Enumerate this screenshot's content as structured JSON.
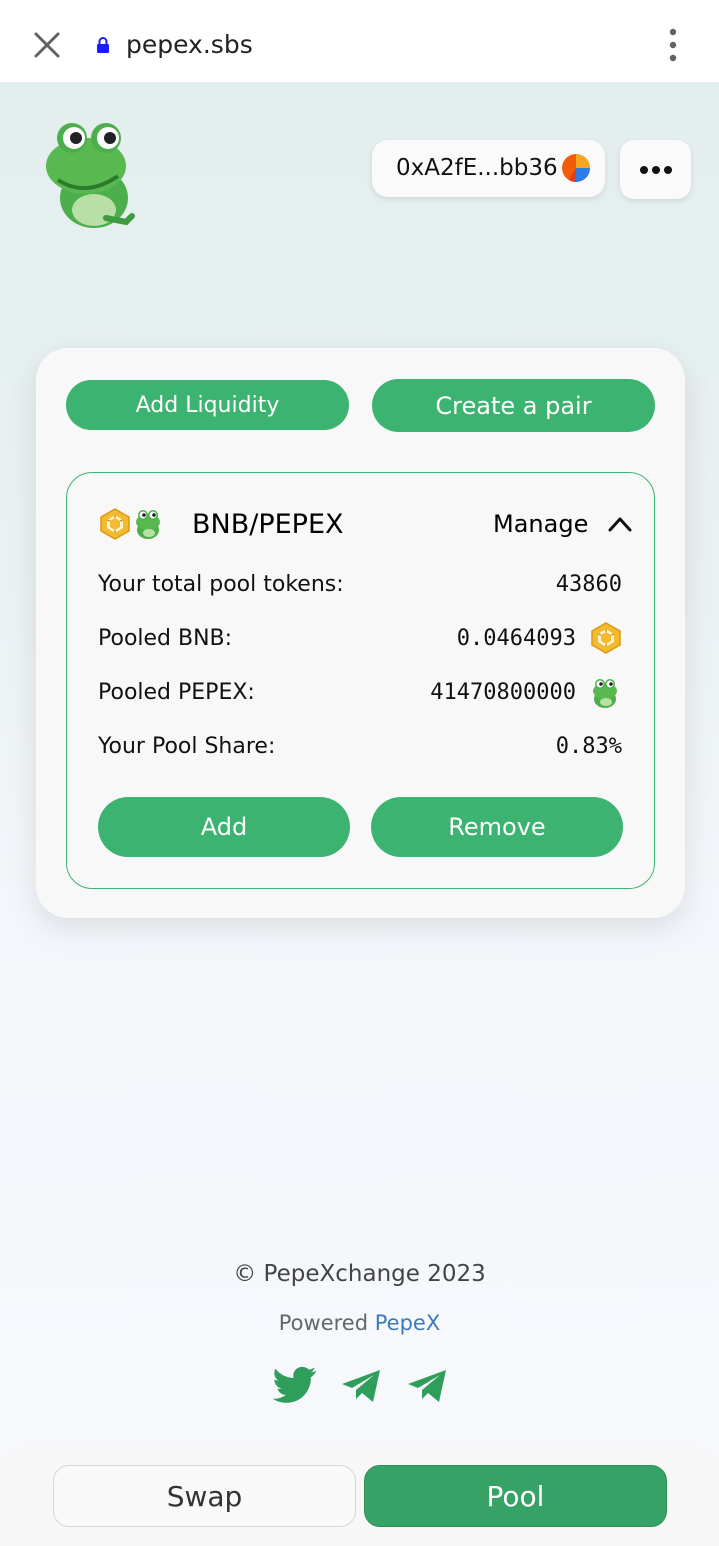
{
  "browser": {
    "url": "pepex.sbs",
    "icons": [
      "close-icon",
      "lock-icon",
      "more-vertical-icon"
    ]
  },
  "header": {
    "wallet_address": "0xA2fE...bb36",
    "logo_icon": "pepe-frog-icon",
    "more_icon": "more-horizontal-icon"
  },
  "pool": {
    "add_liquidity_label": "Add Liquidity",
    "create_pair_label": "Create a pair",
    "pair": {
      "name": "BNB/PEPEX",
      "manage_label": "Manage",
      "rows": [
        {
          "label": "Your total pool tokens:",
          "value": "43860"
        },
        {
          "label": "Pooled BNB:",
          "value": "0.0464093",
          "icon": "bnb-icon"
        },
        {
          "label": "Pooled PEPEX:",
          "value": "41470800000",
          "icon": "pepe-frog-icon"
        },
        {
          "label": "Your Pool Share:",
          "value": "0.83%"
        }
      ],
      "add_label": "Add",
      "remove_label": "Remove"
    }
  },
  "footer": {
    "copyright": "© PepeXchange 2023",
    "powered_prefix": "Powered",
    "powered_link": "PepeX",
    "social_icons": [
      "twitter-icon",
      "telegram-icon",
      "telegram-icon"
    ]
  },
  "nav": {
    "swap_label": "Swap",
    "pool_label": "Pool",
    "active": "Pool"
  },
  "colors": {
    "accent_green": "#3cb371",
    "active_nav_green": "#36a265",
    "link_blue": "#3d7bb8",
    "bnb_yellow": "#f3ba2f"
  }
}
